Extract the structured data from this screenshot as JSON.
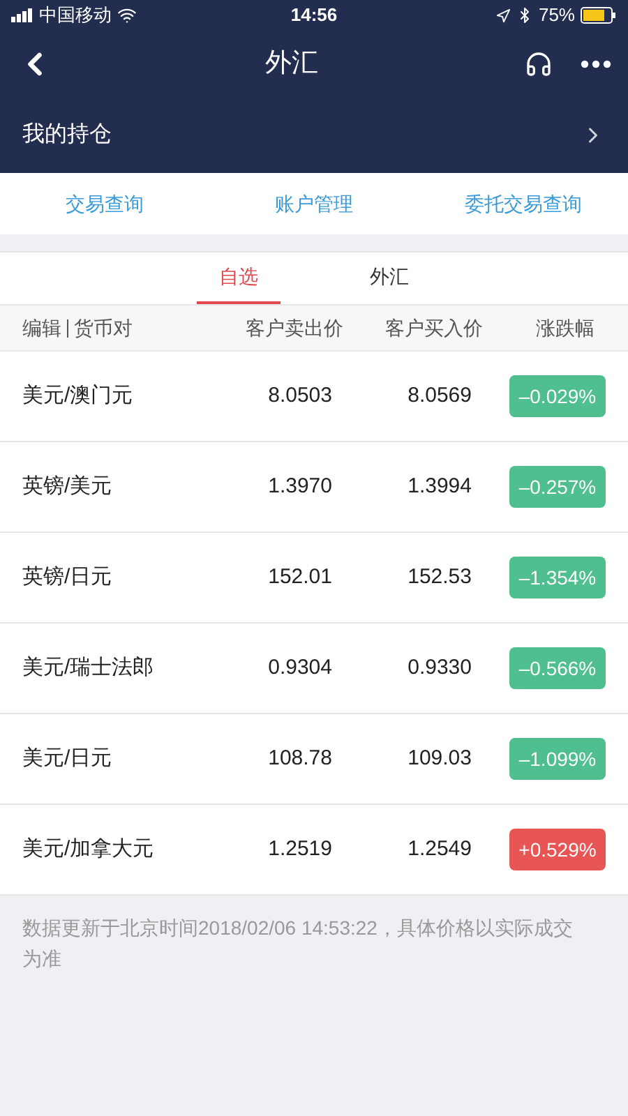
{
  "status_bar": {
    "carrier": "中国移动",
    "time": "14:56",
    "battery": "75%"
  },
  "nav": {
    "title": "外汇"
  },
  "holdings": {
    "label": "我的持仓"
  },
  "links": [
    "交易查询",
    "账户管理",
    "委托交易查询"
  ],
  "tabs": [
    {
      "label": "自选",
      "selected": true
    },
    {
      "label": "外汇",
      "selected": false
    }
  ],
  "table": {
    "columns": [
      "编辑",
      "货币对",
      "客户卖出价",
      "客户买入价",
      "涨跌幅"
    ],
    "rows": [
      {
        "pair": "美元/澳门元",
        "sell": "8.0503",
        "buy": "8.0569",
        "change": "–0.029%",
        "color": "#4fbf8f"
      },
      {
        "pair": "英镑/美元",
        "sell": "1.3970",
        "buy": "1.3994",
        "change": "–0.257%",
        "color": "#4fbf8f"
      },
      {
        "pair": "英镑/日元",
        "sell": "152.01",
        "buy": "152.53",
        "change": "–1.354%",
        "color": "#4fbf8f"
      },
      {
        "pair": "美元/瑞士法郎",
        "sell": "0.9304",
        "buy": "0.9330",
        "change": "–0.566%",
        "color": "#4fbf8f"
      },
      {
        "pair": "美元/日元",
        "sell": "108.78",
        "buy": "109.03",
        "change": "–1.099%",
        "color": "#4fbf8f"
      },
      {
        "pair": "美元/加拿大元",
        "sell": "1.2519",
        "buy": "1.2549",
        "change": "+0.529%",
        "color": "#e85555"
      }
    ]
  },
  "footnote": "数据更新于北京时间2018/02/06 14:53:22，具体价格以实际成交为准"
}
